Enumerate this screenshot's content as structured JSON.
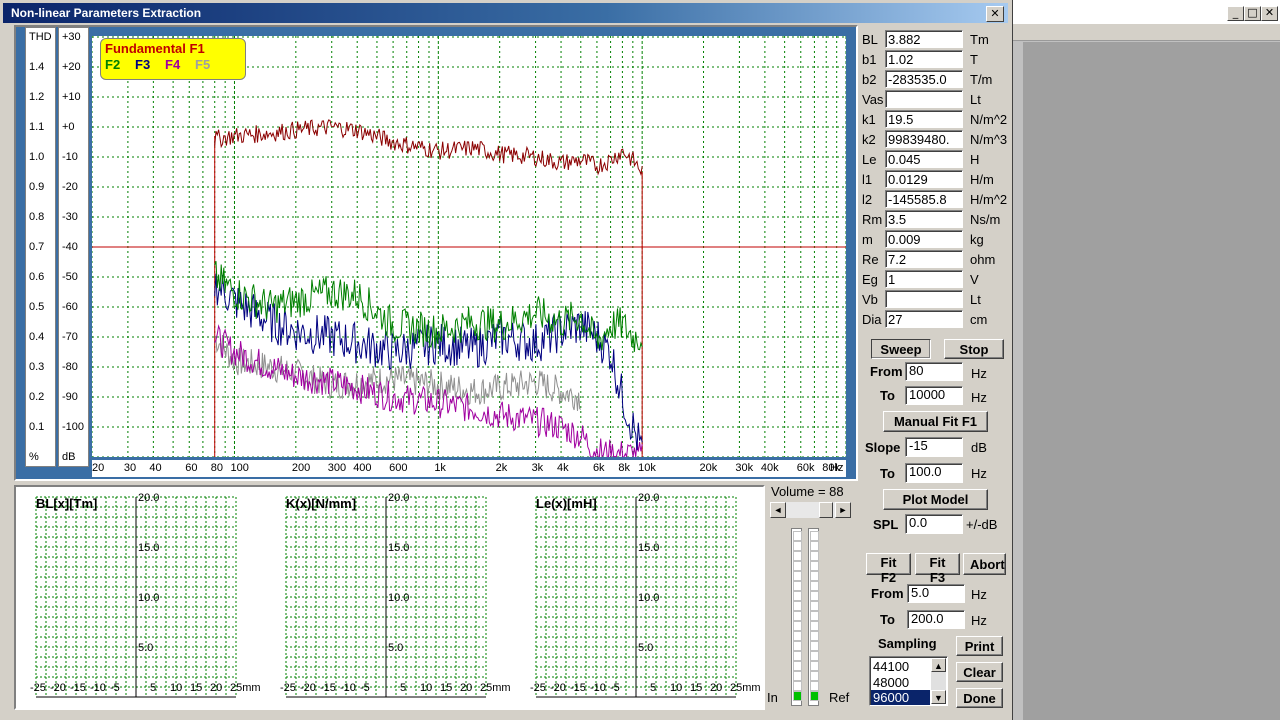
{
  "window": {
    "title": "Non-linear Parameters Extraction",
    "close": "✕"
  },
  "background_window": {
    "minimize": "_",
    "maximize": "□",
    "close": "✕"
  },
  "legend": {
    "f1": "Fundamental F1",
    "f2": "F2",
    "f3": "F3",
    "f4": "F4",
    "f5": "F5"
  },
  "thd_axis": {
    "header": "THD",
    "unit": "%",
    "ticks": [
      "1.4",
      "1.2",
      "1.1",
      "1.0",
      "0.9",
      "0.8",
      "0.7",
      "0.6",
      "0.5",
      "0.4",
      "0.3",
      "0.2",
      "0.1"
    ]
  },
  "db_axis": {
    "unit": "dB",
    "ticks": [
      "+30",
      "+20",
      "+10",
      "+0",
      "-10",
      "-20",
      "-30",
      "-40",
      "-50",
      "-60",
      "-70",
      "-80",
      "-90",
      "-100"
    ]
  },
  "freq_axis": {
    "ticks": [
      "20",
      "30",
      "40",
      "60",
      "80",
      "100",
      "200",
      "300",
      "400",
      "600",
      "1k",
      "2k",
      "3k",
      "4k",
      "6k",
      "8k",
      "10k",
      "20k",
      "30k",
      "40k",
      "60k",
      "80k"
    ],
    "unit": "Hz"
  },
  "colors": {
    "f1": "#8b0000",
    "f2": "#008000",
    "f3": "#000080",
    "f4": "#a000a0",
    "f5": "#909090",
    "accent": "#0a246a",
    "grid": "#008000"
  },
  "chart_data": [
    {
      "type": "line",
      "xscale": "log",
      "xlim": [
        20,
        100000
      ],
      "ylim": [
        -110,
        30
      ],
      "ylabel": "dB",
      "x_ticks": [
        "20",
        "30",
        "40",
        "60",
        "80",
        "100",
        "200",
        "300",
        "400",
        "600",
        "1k",
        "2k",
        "3k",
        "4k",
        "6k",
        "8k",
        "10k",
        "20k",
        "30k",
        "40k",
        "60k",
        "80k"
      ],
      "reference_level": -40,
      "sweep_range": [
        80,
        10000
      ],
      "series": [
        {
          "name": "Fundamental F1",
          "x": [
            80,
            100,
            150,
            200,
            300,
            400,
            600,
            1000,
            1500,
            2000,
            3000,
            4000,
            5000,
            6000,
            7000,
            8000,
            9000,
            10000
          ],
          "y": [
            -4,
            -3,
            -2,
            -1,
            0,
            -1,
            -5,
            -8,
            -7,
            -9,
            -10,
            -12,
            -11,
            -13,
            -11,
            -8,
            -11,
            -15
          ]
        },
        {
          "name": "F2",
          "x": [
            80,
            100,
            150,
            200,
            300,
            400,
            600,
            1000,
            1500,
            2000,
            3000,
            4000,
            5000,
            6000,
            7000,
            8000,
            9000,
            10000
          ],
          "y": [
            -50,
            -55,
            -60,
            -58,
            -55,
            -56,
            -66,
            -68,
            -65,
            -66,
            -62,
            -65,
            -63,
            -72,
            -66,
            -66,
            -70,
            -70
          ]
        },
        {
          "name": "F3",
          "x": [
            80,
            100,
            150,
            200,
            300,
            400,
            600,
            1000,
            1500,
            2000,
            3000,
            4000,
            5000,
            6000,
            7000,
            8000,
            9000,
            10000
          ],
          "y": [
            -52,
            -58,
            -65,
            -68,
            -70,
            -72,
            -75,
            -72,
            -74,
            -70,
            -72,
            -68,
            -66,
            -70,
            -75,
            -90,
            -100,
            -108
          ]
        },
        {
          "name": "F4",
          "x": [
            80,
            100,
            150,
            200,
            300,
            400,
            600,
            1000,
            1500,
            2000,
            3000,
            4000,
            5000,
            6000,
            7000,
            8000,
            9000,
            10000
          ],
          "y": [
            -70,
            -75,
            -80,
            -83,
            -85,
            -87,
            -90,
            -92,
            -94,
            -96,
            -98,
            -100,
            -103,
            -108,
            -109,
            -109,
            -109,
            -110
          ]
        },
        {
          "name": "F5",
          "x": [
            80,
            100,
            150,
            200,
            300,
            400,
            600,
            1000,
            1500,
            2000,
            3000,
            4000,
            5000
          ],
          "y": [
            -70,
            -78,
            -80,
            -82,
            -86,
            -85,
            -84,
            -86,
            -88,
            -87,
            -85,
            -88,
            -90
          ]
        }
      ]
    },
    {
      "type": "line",
      "title": "BL[x][Tm]",
      "xlim": [
        -25,
        25
      ],
      "ylim": [
        0,
        22
      ],
      "x_ticks": [
        "-25",
        "-20",
        "-15",
        "-10",
        "-5",
        "5",
        "10",
        "15",
        "20",
        "25mm"
      ],
      "y_ticks": [
        "20.0",
        "15.0",
        "10.0",
        "5.0"
      ]
    },
    {
      "type": "line",
      "title": "K(x)[N/mm]",
      "xlim": [
        -25,
        25
      ],
      "ylim": [
        0,
        22
      ],
      "x_ticks": [
        "-25",
        "-20",
        "-15",
        "-10",
        "-5",
        "5",
        "10",
        "15",
        "20",
        "25mm"
      ],
      "y_ticks": [
        "20.0",
        "15.0",
        "10.0",
        "5.0"
      ]
    },
    {
      "type": "line",
      "title": "Le(x)[mH]",
      "xlim": [
        -25,
        25
      ],
      "ylim": [
        0,
        22
      ],
      "x_ticks": [
        "-25",
        "-20",
        "-15",
        "-10",
        "-5",
        "5",
        "10",
        "15",
        "20",
        "25mm"
      ],
      "y_ticks": [
        "20.0",
        "15.0",
        "10.0",
        "5.0"
      ]
    }
  ],
  "params": [
    {
      "label": "BL",
      "value": "3.882",
      "unit": "Tm"
    },
    {
      "label": "b1",
      "value": "1.02",
      "unit": "T"
    },
    {
      "label": "b2",
      "value": "-283535.0",
      "unit": "T/m"
    },
    {
      "label": "Vas",
      "value": "",
      "unit": "Lt"
    },
    {
      "label": "k1",
      "value": "19.5",
      "unit": "N/m^2"
    },
    {
      "label": "k2",
      "value": "99839480.",
      "unit": "N/m^3"
    },
    {
      "label": "Le",
      "value": "0.045",
      "unit": "H"
    },
    {
      "label": "l1",
      "value": "0.0129",
      "unit": "H/m"
    },
    {
      "label": "l2",
      "value": "-145585.8",
      "unit": "H/m^2"
    },
    {
      "label": "Rm",
      "value": "3.5",
      "unit": "Ns/m"
    },
    {
      "label": "m",
      "value": "0.009",
      "unit": "kg"
    },
    {
      "label": "Re",
      "value": "7.2",
      "unit": "ohm"
    },
    {
      "label": "Eg",
      "value": "1",
      "unit": "V"
    },
    {
      "label": "Vb",
      "value": "",
      "unit": "Lt"
    },
    {
      "label": "Dia",
      "value": "27",
      "unit": "cm"
    }
  ],
  "sweep": {
    "sweep_btn": "Sweep",
    "stop_btn": "Stop",
    "from_label": "From",
    "from_value": "80",
    "to_label": "To",
    "to_value": "10000",
    "unit": "Hz"
  },
  "fit": {
    "manual_btn": "Manual Fit F1",
    "slope_label": "Slope",
    "slope_value": "-15",
    "slope_unit": "dB",
    "to_label": "To",
    "to_value": "100.0",
    "to_unit": "Hz",
    "plot_btn": "Plot Model",
    "spl_label": "SPL",
    "spl_value": "0.0",
    "spl_unit": "+/-dB"
  },
  "fit2": {
    "f2_btn": "Fit F2",
    "f3_btn": "Fit F3",
    "abort_btn": "Abort",
    "from_label": "From",
    "from_value": "5.0",
    "to_label": "To",
    "to_value": "200.0",
    "unit": "Hz"
  },
  "sampling": {
    "label": "Sampling",
    "options": [
      "44100",
      "48000",
      "96000"
    ],
    "selected": "96000",
    "print_btn": "Print",
    "clear_btn": "Clear",
    "done_btn": "Done"
  },
  "volume": {
    "label": "Volume = 88",
    "value": 88,
    "in_label": "In",
    "ref_label": "Ref"
  }
}
